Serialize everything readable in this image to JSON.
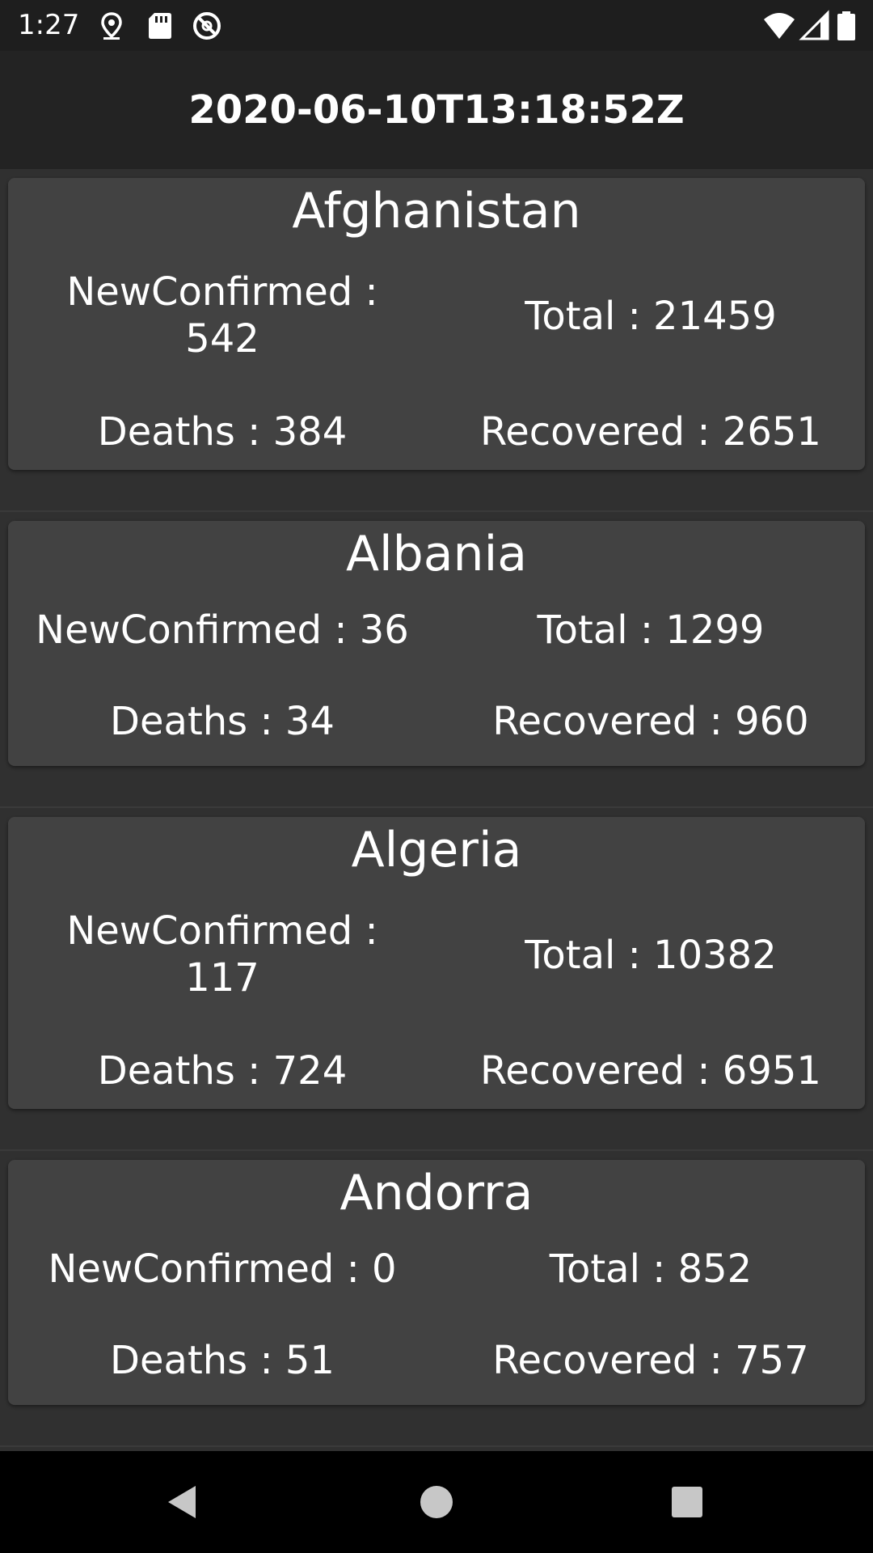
{
  "status_bar": {
    "time": "1:27",
    "icons": [
      "location-icon",
      "sd-card-icon",
      "no-disturb-icon",
      "wifi-icon",
      "cell-signal-icon",
      "battery-icon"
    ]
  },
  "app_bar": {
    "title": "2020-06-10T13:18:52Z"
  },
  "colors": {
    "status_bar": "#1e1e1e",
    "app_bar": "#232323",
    "background": "#303030",
    "card": "#424242",
    "text": "#ffffff"
  },
  "countries": [
    {
      "name": "Afghanistan",
      "new_confirmed": "NewConfirmed : 542",
      "total": "Total : 21459",
      "deaths": "Deaths : 384",
      "recovered": "Recovered : 2651"
    },
    {
      "name": "Albania",
      "new_confirmed": "NewConfirmed : 36",
      "total": "Total : 1299",
      "deaths": "Deaths : 34",
      "recovered": "Recovered : 960"
    },
    {
      "name": "Algeria",
      "new_confirmed": "NewConfirmed : 117",
      "total": "Total : 10382",
      "deaths": "Deaths : 724",
      "recovered": "Recovered : 6951"
    },
    {
      "name": "Andorra",
      "new_confirmed": "NewConfirmed : 0",
      "total": "Total : 852",
      "deaths": "Deaths : 51",
      "recovered": "Recovered : 757"
    }
  ],
  "nav_bar": {
    "buttons": [
      "back-icon",
      "home-icon",
      "recents-icon"
    ]
  }
}
